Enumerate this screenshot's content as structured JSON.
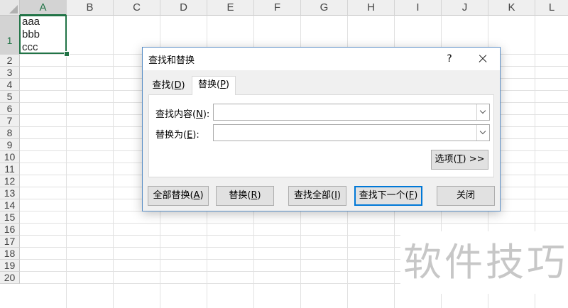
{
  "spreadsheet": {
    "columns": [
      "A",
      "B",
      "C",
      "D",
      "E",
      "F",
      "G",
      "H",
      "I",
      "J",
      "K",
      "L"
    ],
    "rows": [
      "1",
      "2",
      "3",
      "4",
      "5",
      "6",
      "7",
      "8",
      "9",
      "10",
      "11",
      "12",
      "13",
      "14",
      "15",
      "16",
      "17",
      "18",
      "19",
      "20"
    ],
    "active_cell": "A1",
    "cell_a1_lines": [
      "aaa",
      "bbb",
      "ccc"
    ]
  },
  "dialog": {
    "title": "查找和替换",
    "help_label": "?",
    "tabs": [
      {
        "label": "查找(",
        "key": "D",
        "suffix": ")"
      },
      {
        "label": "替换(",
        "key": "P",
        "suffix": ")"
      }
    ],
    "active_tab": "替换",
    "find_label": {
      "text": "查找内容(",
      "key": "N",
      "suffix": "):"
    },
    "replace_label": {
      "text": "替换为(",
      "key": "E",
      "suffix": "):"
    },
    "find_value": "",
    "replace_value": "",
    "options_button": {
      "text": "选项(",
      "key": "T",
      "suffix": ") >>"
    },
    "buttons": [
      {
        "text": "全部替换(",
        "key": "A",
        "suffix": ")"
      },
      {
        "text": "替换(",
        "key": "R",
        "suffix": ")"
      },
      {
        "text": "查找全部(",
        "key": "I",
        "suffix": ")"
      },
      {
        "text": "查找下一个(",
        "key": "F",
        "suffix": ")"
      },
      {
        "text": "关闭",
        "key": "",
        "suffix": ""
      }
    ]
  },
  "watermark": "软件技巧"
}
